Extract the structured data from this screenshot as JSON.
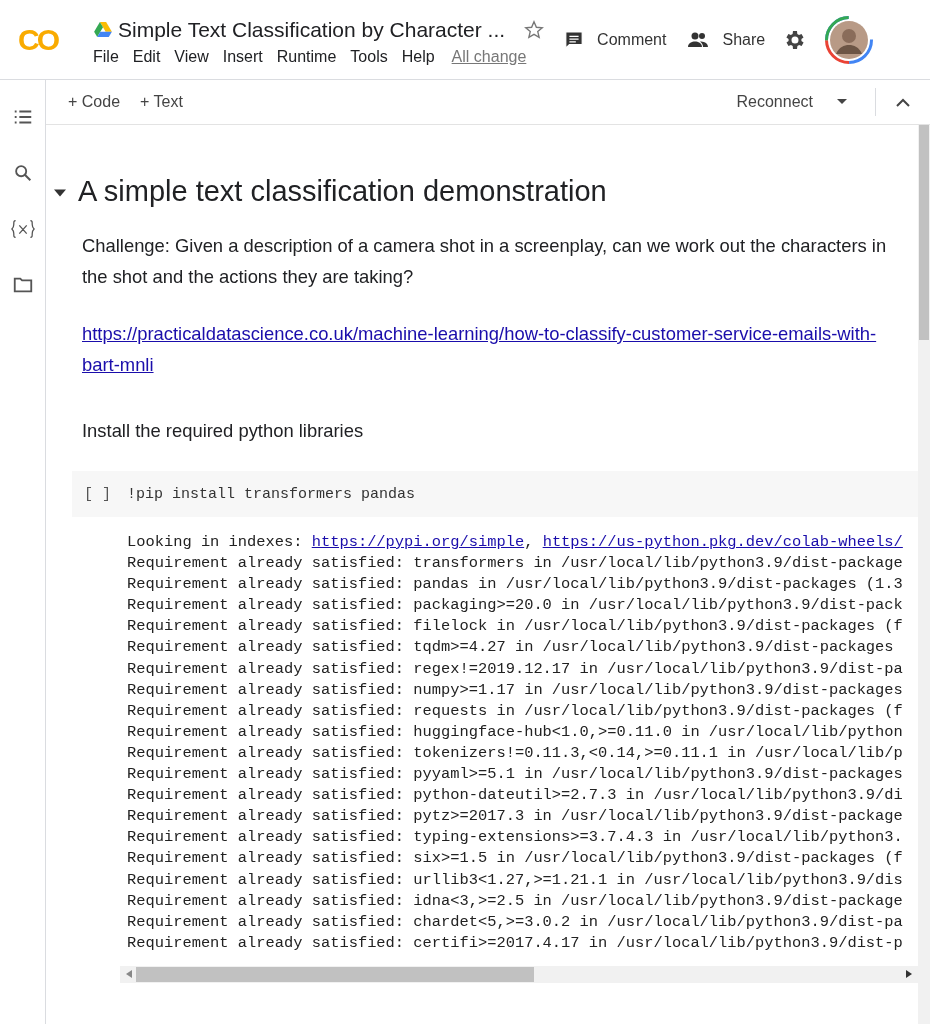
{
  "header": {
    "logo": "CO",
    "title": "Simple Text Classification by Character ...",
    "starred": false,
    "menu": [
      "File",
      "Edit",
      "View",
      "Insert",
      "Runtime",
      "Tools",
      "Help"
    ],
    "changes_link": "All change",
    "comment": "Comment",
    "share": "Share"
  },
  "toolbar": {
    "add_code": "+ Code",
    "add_text": "+ Text",
    "connect": "Reconnect"
  },
  "text_cell": {
    "heading": "A simple text classification demonstration",
    "expanded": true,
    "challenge": "Challenge: Given a description of a camera shot in a screenplay, can we work out the characters in the shot and the actions they are taking?",
    "link": "https://practicaldatascience.co.uk/machine-learning/how-to-classify-customer-service-emails-with-bart-mnli",
    "note": "Install the required python libraries"
  },
  "code_cell": {
    "run_marker": "[ ]",
    "code": "!pip install transformers pandas",
    "output_first_line": [
      {
        "kind": "text",
        "text": "Looking in indexes: "
      },
      {
        "kind": "link",
        "text": "https://pypi.org/simple"
      },
      {
        "kind": "text",
        "text": ", "
      },
      {
        "kind": "link",
        "text": "https://us-python.pkg.dev/colab-wheels/"
      }
    ],
    "output_lines": [
      "Requirement already satisfied: transformers in /usr/local/lib/python3.9/dist-package",
      "Requirement already satisfied: pandas in /usr/local/lib/python3.9/dist-packages (1.3",
      "Requirement already satisfied: packaging>=20.0 in /usr/local/lib/python3.9/dist-pack",
      "Requirement already satisfied: filelock in /usr/local/lib/python3.9/dist-packages (f",
      "Requirement already satisfied: tqdm>=4.27 in /usr/local/lib/python3.9/dist-packages",
      "Requirement already satisfied: regex!=2019.12.17 in /usr/local/lib/python3.9/dist-pa",
      "Requirement already satisfied: numpy>=1.17 in /usr/local/lib/python3.9/dist-packages",
      "Requirement already satisfied: requests in /usr/local/lib/python3.9/dist-packages (f",
      "Requirement already satisfied: huggingface-hub<1.0,>=0.11.0 in /usr/local/lib/python",
      "Requirement already satisfied: tokenizers!=0.11.3,<0.14,>=0.11.1 in /usr/local/lib/p",
      "Requirement already satisfied: pyyaml>=5.1 in /usr/local/lib/python3.9/dist-packages",
      "Requirement already satisfied: python-dateutil>=2.7.3 in /usr/local/lib/python3.9/di",
      "Requirement already satisfied: pytz>=2017.3 in /usr/local/lib/python3.9/dist-package",
      "Requirement already satisfied: typing-extensions>=3.7.4.3 in /usr/local/lib/python3.",
      "Requirement already satisfied: six>=1.5 in /usr/local/lib/python3.9/dist-packages (f",
      "Requirement already satisfied: urllib3<1.27,>=1.21.1 in /usr/local/lib/python3.9/dis",
      "Requirement already satisfied: idna<3,>=2.5 in /usr/local/lib/python3.9/dist-package",
      "Requirement already satisfied: chardet<5,>=3.0.2 in /usr/local/lib/python3.9/dist-pa",
      "Requirement already satisfied: certifi>=2017.4.17 in /usr/local/lib/python3.9/dist-p"
    ]
  }
}
